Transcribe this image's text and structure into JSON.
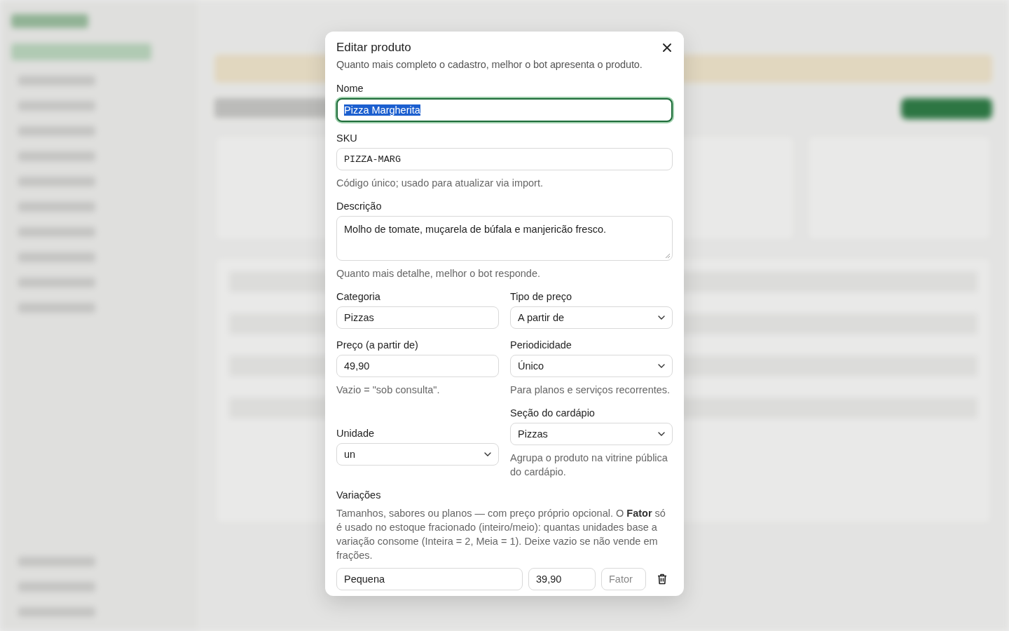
{
  "modal": {
    "title": "Editar produto",
    "subtitle": "Quanto mais completo o cadastro, melhor o bot apresenta o produto.",
    "rows": [
      [
        {
          "kind": "text",
          "label": "Nome",
          "value": "Pizza Margherita",
          "focused": true,
          "text_selected": true
        }
      ],
      [
        {
          "kind": "mono",
          "label": "SKU",
          "value": "PIZZA-MARG",
          "hint": "Código único; usado para atualizar via import."
        }
      ],
      [
        {
          "kind": "textarea",
          "label": "Descrição",
          "value": "Molho de tomate, muçarela de búfala e manjericão fresco.",
          "hint": "Quanto mais detalhe, melhor o bot responde."
        }
      ],
      [
        {
          "kind": "text",
          "label": "Categoria",
          "value": "Pizzas"
        },
        {
          "kind": "select",
          "label": "Tipo de preço",
          "value": "A partir de"
        }
      ],
      [
        {
          "kind": "text",
          "label": "Preço (a partir de)",
          "value": "49,90",
          "hint": "Vazio = \"sob consulta\"."
        },
        {
          "kind": "select",
          "label": "Periodicidade",
          "value": "Único",
          "hint": "Para planos e serviços recorrentes."
        }
      ],
      [
        {
          "kind": "select",
          "label": "Unidade",
          "value": "un"
        },
        {
          "kind": "select",
          "label": "Seção do cardápio",
          "value": "Pizzas",
          "hint": "Agrupa o produto na vitrine pública do cardápio."
        }
      ]
    ],
    "variations": {
      "label": "Variações",
      "hint": "Tamanhos, sabores ou planos — com preço próprio opcional. O **Fator** só é usado no estoque fracionado (inteiro/meio): quantas unidades base a variação consome (Inteira = 2, Meia = 1). Deixe vazio se não vende em frações.",
      "items": [
        {
          "name": "Pequena",
          "price": "39,90",
          "factor_placeholder": "Fator"
        }
      ]
    }
  }
}
